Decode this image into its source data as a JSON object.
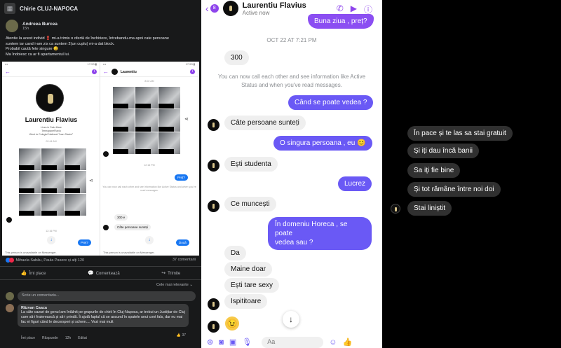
{
  "facebook": {
    "group_name": "Chirie CLUJ-NAPOCA",
    "author": "Andreea Burcea",
    "time": "15h",
    "post_lines": [
      "Atentie la acest individ ‼️ mi-a trimis o ofertă de închiriere, întrebandu-ma apoi cate persoane",
      "suntem iar cand i-am zis ca suntem 2(un cuplu) mi-a dat block.",
      "Probabil caută fete singure 😐",
      "Ma îndoiesc ca ar fi apartamentul lui."
    ],
    "screenshot_left": {
      "profile_name": "Laurentiu Flavius",
      "sub_lines": [
        "Lives in Satu Mare",
        "TermopaneFlaviu",
        "Went to Colegiul National \"Ioan Slavici\""
      ],
      "timestamp": "02:44 AM",
      "bottom_time": "12:16 PM",
      "out_msg": "Preț?",
      "unavailable": "This person is unavailable on Messenger."
    },
    "screenshot_right": {
      "header_name": "Laurentiu",
      "top_time": "8:02 AM",
      "mid_time": "12:16 PM",
      "out_msg": "Preț?",
      "note": "You can now call each other and see information like Active Status and when you've read messages.",
      "in_msg_1": "300 e",
      "in_msg_2": "Câte persoane sunteți",
      "out_msg_2": "Două",
      "unavailable": "This person is unavailable on Messenger."
    },
    "reactions_text": "Mihaela Sabău, Paula Pasere și alți 120",
    "comments_count": "37 comentarii",
    "actions": [
      "Îmi place",
      "Comentează",
      "Trimite"
    ],
    "sort_label": "Cele mai relevante ⌄",
    "write_placeholder": "Scrie un comentariu...",
    "comment_author": "Răzvan Caaca",
    "comment_text": "La câte cazuri de genul am întâlnit pe grupurile de chirii în Cluj-Napoca, ar trebui un Justițiar de Cluj care să-i fraierească și să-i prindă. Îi ajută faptul că se ascund în spatele unui cont fals, dar nu mai fac ei figuri când le decorsperi și schem.... Vezi mai mult",
    "comment_actions": [
      "Îmi place",
      "Răspunde",
      "12h",
      "Editat"
    ],
    "comment_reactions": "37"
  },
  "messenger": {
    "name": "Laurentiu Flavius",
    "status": "Active now",
    "badge": "8",
    "messages": {
      "m0": "Buna ziua , preț?",
      "ts": "OCT 22 AT 7:21 PM",
      "m1": "300",
      "note": "You can now call each other and see information like Active Status and when you've read messages.",
      "m2": "Când se poate vedea ?",
      "m3": "Câte persoane sunteți",
      "m4": "O singura persoana , eu 😊",
      "m5": "Ești studenta",
      "m6": "Lucrez",
      "m7": "Ce muncești",
      "m8a": "În domeniu Horeca , se poate",
      "m8b": "vedea sau ?",
      "m9": "Da",
      "m10": "Maine doar",
      "m11": "Ești tare sexy",
      "m12": "Ispititoare",
      "m13": "😉"
    },
    "input_placeholder": "Aa"
  },
  "dark_chat": {
    "messages": [
      "În pace și te las sa stai gratuit",
      "Și iți dau încă banii",
      "Sa iți fie bine",
      "Și tot rămâne între noi doi",
      "Stai liniștit"
    ]
  }
}
